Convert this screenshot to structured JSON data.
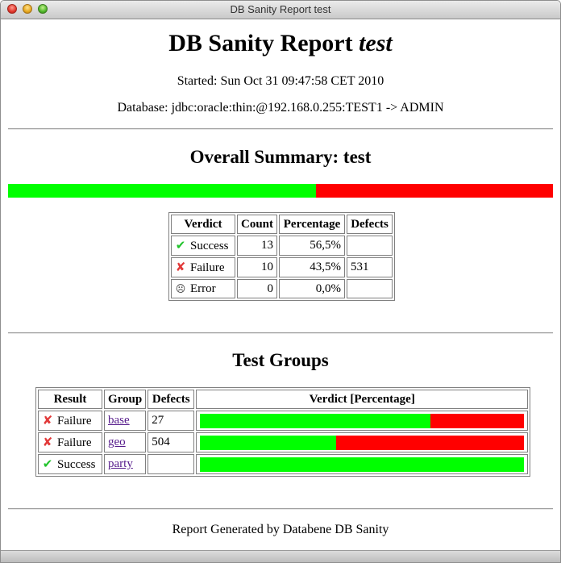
{
  "window": {
    "title": "DB Sanity Report test"
  },
  "report": {
    "title_main": "DB Sanity Report",
    "title_em": "test",
    "started": "Started: Sun Oct 31 09:47:58 CET 2010",
    "database": "Database: jdbc:oracle:thin:@192.168.0.255:TEST1 -> ADMIN"
  },
  "overall": {
    "heading": "Overall Summary: test",
    "success_fraction": 0.565,
    "failure_fraction": 0.435,
    "headers": {
      "verdict": "Verdict",
      "count": "Count",
      "percentage": "Percentage",
      "defects": "Defects"
    },
    "rows": [
      {
        "icon": "check-icon",
        "verdict": "Success",
        "count": "13",
        "percentage": "56,5%",
        "defects": ""
      },
      {
        "icon": "cross-icon",
        "verdict": "Failure",
        "count": "10",
        "percentage": "43,5%",
        "defects": "531"
      },
      {
        "icon": "error-face-icon",
        "verdict": "Error",
        "count": "0",
        "percentage": "0,0%",
        "defects": ""
      }
    ]
  },
  "groups": {
    "heading": "Test Groups",
    "headers": {
      "result": "Result",
      "group": "Group",
      "defects": "Defects",
      "verdict": "Verdict [Percentage]"
    },
    "rows": [
      {
        "icon": "cross-icon",
        "result": "Failure",
        "group": "base",
        "defects": "27",
        "success_fraction": 0.71
      },
      {
        "icon": "cross-icon",
        "result": "Failure",
        "group": "geo",
        "defects": "504",
        "success_fraction": 0.42
      },
      {
        "icon": "check-icon",
        "result": "Success",
        "group": "party",
        "defects": "",
        "success_fraction": 1.0
      }
    ]
  },
  "colors": {
    "success": "#00ff00",
    "failure": "#ff0000",
    "link": "#551a8b"
  },
  "footer": {
    "text": "Report Generated by Databene DB Sanity"
  }
}
